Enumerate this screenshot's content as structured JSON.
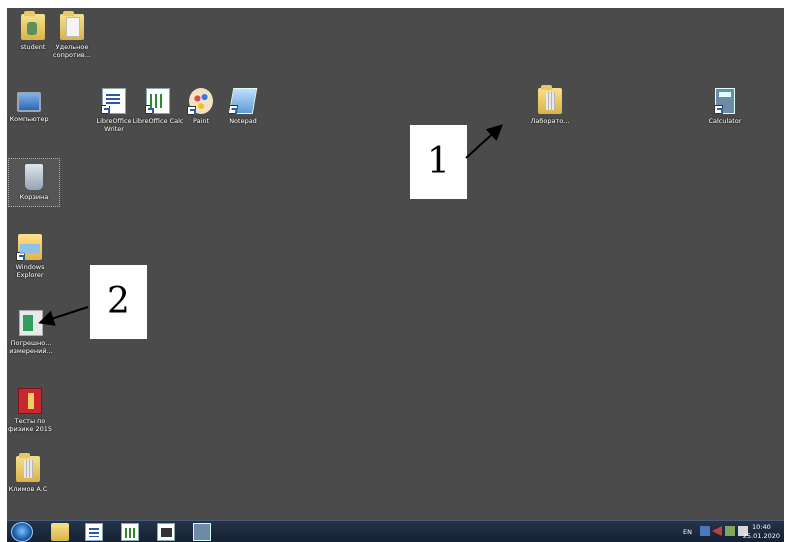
{
  "desktop": {
    "icons": [
      {
        "label": "student",
        "icon": "user-folder-icon"
      },
      {
        "label": "Удельное сопротив...",
        "icon": "folder-icon"
      },
      {
        "label": "Компьютер",
        "icon": "computer-icon"
      },
      {
        "label": "LibreOffice Writer",
        "icon": "libreoffice-writer-icon"
      },
      {
        "label": "LibreOffice Calc",
        "icon": "libreoffice-calc-icon"
      },
      {
        "label": "Paint",
        "icon": "paint-icon"
      },
      {
        "label": "Notepad",
        "icon": "notepad-icon"
      },
      {
        "label": "Лаборато...",
        "icon": "folder-icon"
      },
      {
        "label": "Calculator",
        "icon": "calculator-icon"
      },
      {
        "label": "Корзина",
        "icon": "recycle-bin-icon"
      },
      {
        "label": "Windows Explorer",
        "icon": "windows-explorer-icon"
      },
      {
        "label": "Погрешно... измерений...",
        "icon": "application-icon"
      },
      {
        "label": "Тесты по физике 2015",
        "icon": "red-book-icon"
      },
      {
        "label": "Климов А.С",
        "icon": "folder-icon"
      }
    ]
  },
  "annotations": {
    "label1": "1",
    "label2": "2"
  },
  "taskbar": {
    "language": "EN",
    "time": "10:40",
    "date": "25.01.2020",
    "pinned": [
      "windows-explorer-icon",
      "libreoffice-writer-icon",
      "libreoffice-calc-icon",
      "libreoffice-draw-icon",
      "calculator-icon"
    ]
  },
  "colors": {
    "desktop_background": "#4b4b4b",
    "taskbar_background": "#1b2a3f"
  }
}
